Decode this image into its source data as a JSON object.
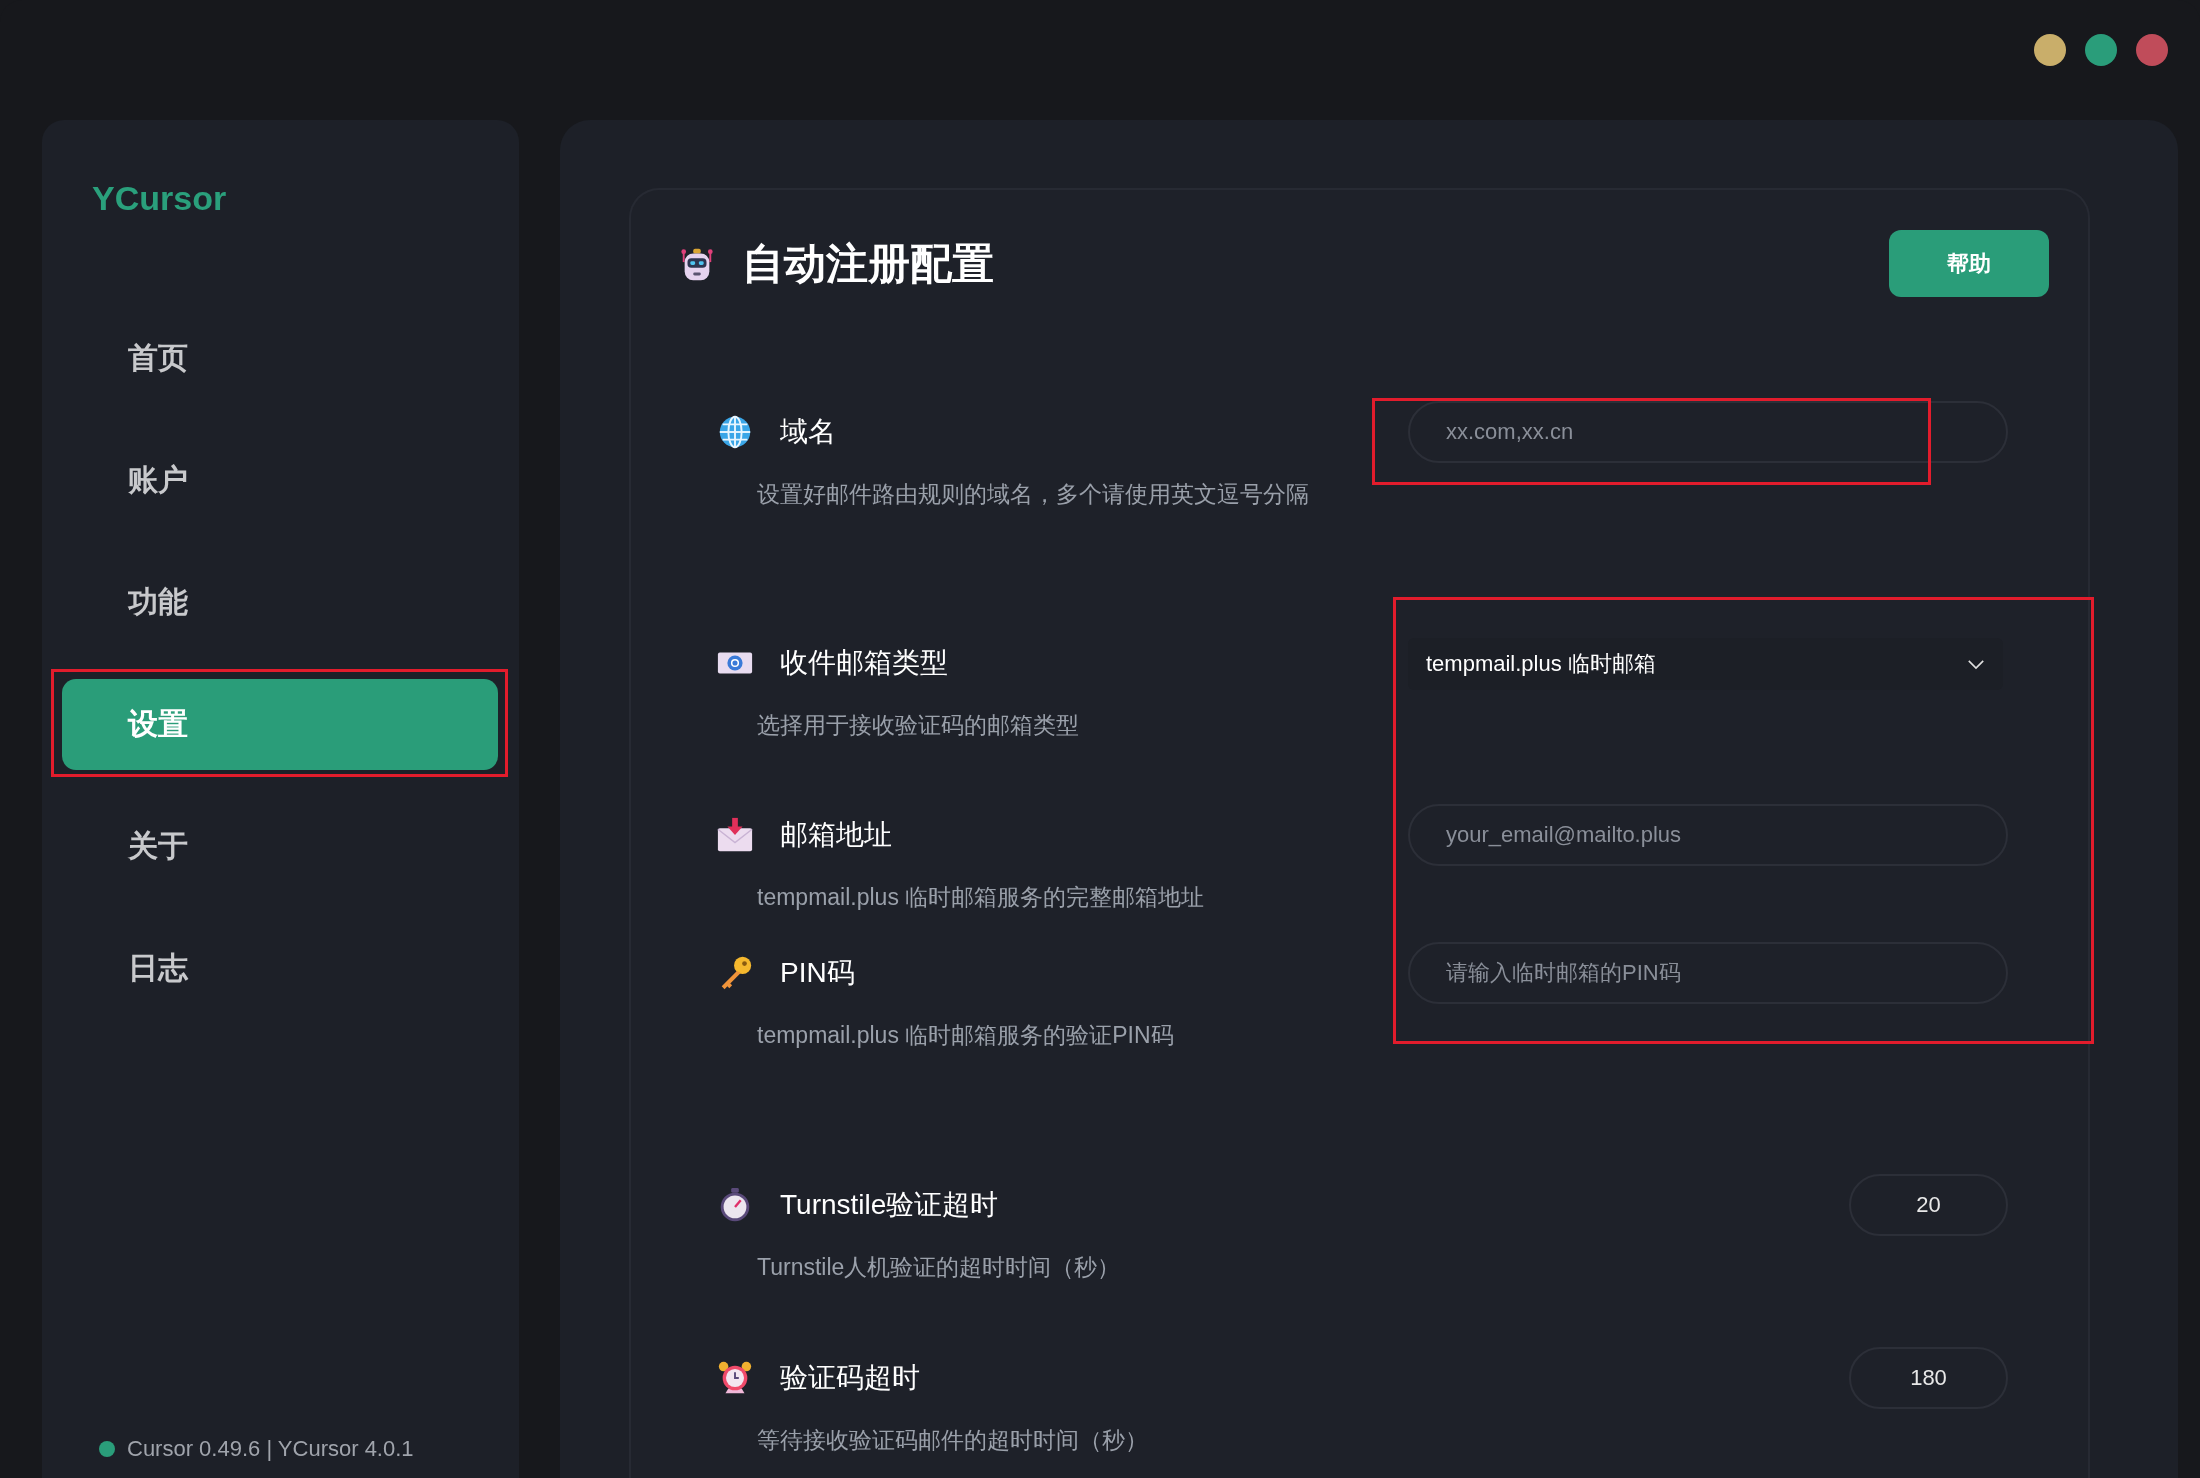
{
  "window": {
    "controls": [
      {
        "color": "#c9ae6a"
      },
      {
        "color": "#2a9d7a"
      },
      {
        "color": "#c04c5a"
      }
    ]
  },
  "sidebar": {
    "logo": "YCursor",
    "items": [
      {
        "label": "首页",
        "selected": false,
        "highlighted": false
      },
      {
        "label": "账户",
        "selected": false,
        "highlighted": false
      },
      {
        "label": "功能",
        "selected": false,
        "highlighted": false
      },
      {
        "label": "设置",
        "selected": true,
        "highlighted": true
      },
      {
        "label": "关于",
        "selected": false,
        "highlighted": false
      },
      {
        "label": "日志",
        "selected": false,
        "highlighted": false
      }
    ],
    "status": {
      "color": "#2a9d7a",
      "text": "Cursor 0.49.6 | YCursor 4.0.1"
    }
  },
  "panel": {
    "title": "自动注册配置",
    "help_button": "帮助",
    "sections": [
      {
        "highlighted": true,
        "settings": [
          {
            "kind": "globe",
            "label": "域名",
            "description": "设置好邮件路由规则的域名，多个请使用英文逗号分隔",
            "control": {
              "kind": "input",
              "placeholder": "xx.com,xx.cn"
            }
          }
        ]
      },
      {
        "highlighted": true,
        "settings": [
          {
            "kind": "mail-at",
            "label": "收件邮箱类型",
            "description": "选择用于接收验证码的邮箱类型",
            "control": {
              "kind": "select",
              "value": "tempmail.plus 临时邮箱"
            }
          },
          {
            "kind": "mail-in",
            "label": "邮箱地址",
            "description": "tempmail.plus 临时邮箱服务的完整邮箱地址",
            "control": {
              "kind": "input",
              "placeholder": "your_email@mailto.plus"
            }
          },
          {
            "kind": "key",
            "label": "PIN码",
            "description": "tempmail.plus 临时邮箱服务的验证PIN码",
            "control": {
              "kind": "input",
              "placeholder": "请输入临时邮箱的PIN码"
            }
          }
        ]
      },
      {
        "highlighted": false,
        "settings": [
          {
            "kind": "stopwatch",
            "label": "Turnstile验证超时",
            "description": "Turnstile人机验证的超时时间（秒）",
            "control": {
              "kind": "number",
              "value": "20"
            }
          },
          {
            "kind": "alarm",
            "label": "验证码超时",
            "description": "等待接收验证码邮件的超时时间（秒）",
            "control": {
              "kind": "number",
              "value": "180"
            }
          }
        ]
      }
    ]
  }
}
